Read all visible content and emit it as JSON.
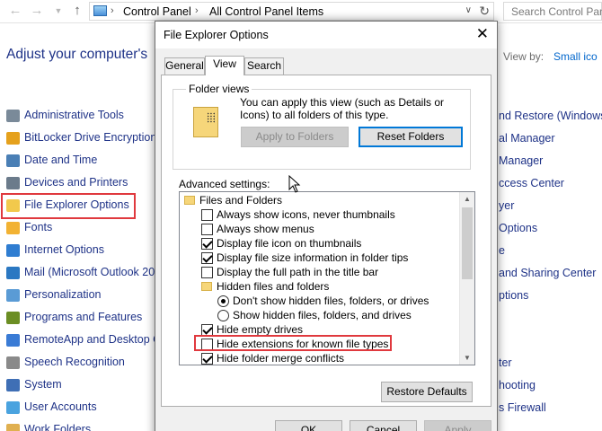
{
  "addressbar": {
    "breadcrumbs": [
      "Control Panel",
      "All Control Panel Items"
    ],
    "search_placeholder": "Search Control Pane"
  },
  "control_panel": {
    "heading": "Adjust your computer's",
    "view_by_label": "View by:",
    "view_by_value": "Small ico",
    "left_items": [
      {
        "label": "Administrative Tools",
        "icon": "admin-tools-icon"
      },
      {
        "label": "BitLocker Drive Encryption",
        "icon": "bitlocker-icon"
      },
      {
        "label": "Date and Time",
        "icon": "clock-icon"
      },
      {
        "label": "Devices and Printers",
        "icon": "printer-icon"
      },
      {
        "label": "File Explorer Options",
        "icon": "folder-options-icon"
      },
      {
        "label": "Fonts",
        "icon": "fonts-icon"
      },
      {
        "label": "Internet Options",
        "icon": "globe-icon"
      },
      {
        "label": "Mail (Microsoft Outlook 20",
        "icon": "mail-icon"
      },
      {
        "label": "Personalization",
        "icon": "personalization-icon"
      },
      {
        "label": "Programs and Features",
        "icon": "programs-icon"
      },
      {
        "label": "RemoteApp and Desktop Co",
        "icon": "remoteapp-icon"
      },
      {
        "label": "Speech Recognition",
        "icon": "microphone-icon"
      },
      {
        "label": "System",
        "icon": "system-icon"
      },
      {
        "label": "User Accounts",
        "icon": "users-icon"
      },
      {
        "label": "Work Folders",
        "icon": "work-folders-icon"
      }
    ],
    "right_fragments": [
      "nd Restore (Windows",
      "al Manager",
      "Manager",
      "ccess Center",
      "yer",
      "Options",
      "e",
      "and Sharing Center",
      "ptions",
      "ter",
      "hooting",
      "s Firewall"
    ]
  },
  "dialog": {
    "title": "File Explorer Options",
    "tabs": [
      "General",
      "View",
      "Search"
    ],
    "active_tab": "View",
    "folder_views": {
      "legend": "Folder views",
      "description": "You can apply this view (such as Details or Icons) to all folders of this type.",
      "apply_button": "Apply to Folders",
      "reset_button": "Reset Folders"
    },
    "advanced_label": "Advanced settings:",
    "tree": [
      {
        "type": "folder",
        "label": "Files and Folders",
        "indent": 0
      },
      {
        "type": "checkbox",
        "label": "Always show icons, never thumbnails",
        "checked": false,
        "indent": 1
      },
      {
        "type": "checkbox",
        "label": "Always show menus",
        "checked": false,
        "indent": 1
      },
      {
        "type": "checkbox",
        "label": "Display file icon on thumbnails",
        "checked": true,
        "indent": 1
      },
      {
        "type": "checkbox",
        "label": "Display file size information in folder tips",
        "checked": true,
        "indent": 1
      },
      {
        "type": "checkbox",
        "label": "Display the full path in the title bar",
        "checked": false,
        "indent": 1
      },
      {
        "type": "folder",
        "label": "Hidden files and folders",
        "indent": 1
      },
      {
        "type": "radio",
        "label": "Don't show hidden files, folders, or drives",
        "checked": true,
        "indent": 2
      },
      {
        "type": "radio",
        "label": "Show hidden files, folders, and drives",
        "checked": false,
        "indent": 2
      },
      {
        "type": "checkbox",
        "label": "Hide empty drives",
        "checked": true,
        "indent": 1
      },
      {
        "type": "checkbox",
        "label": "Hide extensions for known file types",
        "checked": false,
        "indent": 1
      },
      {
        "type": "checkbox",
        "label": "Hide folder merge conflicts",
        "checked": true,
        "indent": 1
      }
    ],
    "restore_button": "Restore Defaults",
    "ok_button": "OK",
    "cancel_button": "Cancel",
    "apply_button": "Apply"
  },
  "colors": {
    "link_blue": "#1e3287",
    "highlight_red": "#e0393e",
    "focus_blue": "#0078d7"
  }
}
